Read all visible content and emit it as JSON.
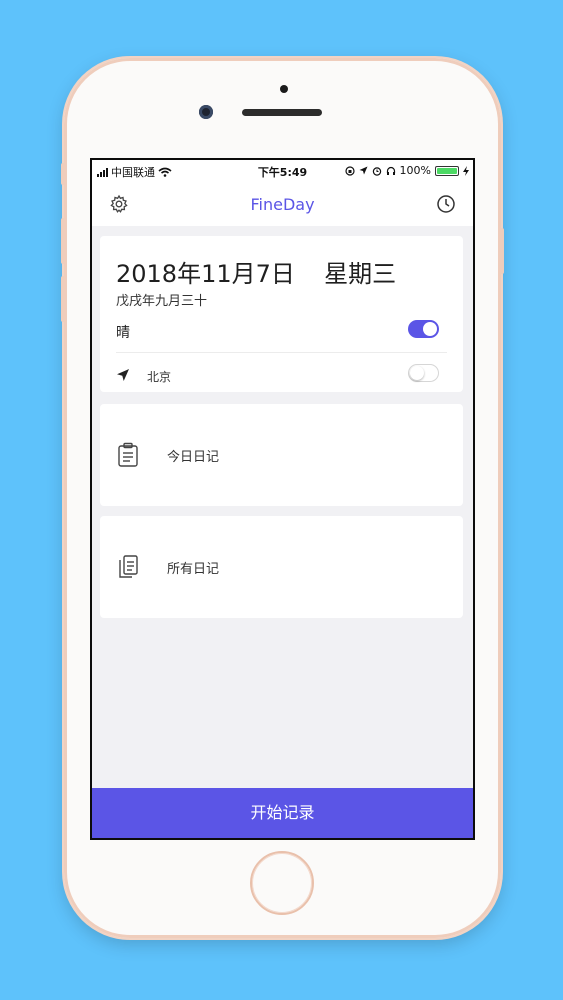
{
  "statusbar": {
    "carrier": "中国联通",
    "time": "下午5:49",
    "battery": "100%"
  },
  "nav": {
    "title": "FineDay",
    "left_icon": "gear-icon",
    "right_icon": "clock-icon"
  },
  "date_card": {
    "date": "2018年11月7日",
    "weekday": "星期三",
    "lunar": "戊戌年九月三十",
    "weather": "晴",
    "weather_toggle_on": true,
    "location": "北京",
    "location_toggle_on": false
  },
  "entries": [
    {
      "label": "今日日记",
      "icon": "clipboard-icon"
    },
    {
      "label": "所有日记",
      "icon": "documents-icon"
    }
  ],
  "cta": {
    "label": "开始记录"
  },
  "colors": {
    "background": "#5ec2fb",
    "accent": "#5b55e6",
    "battery": "#4cd964"
  }
}
